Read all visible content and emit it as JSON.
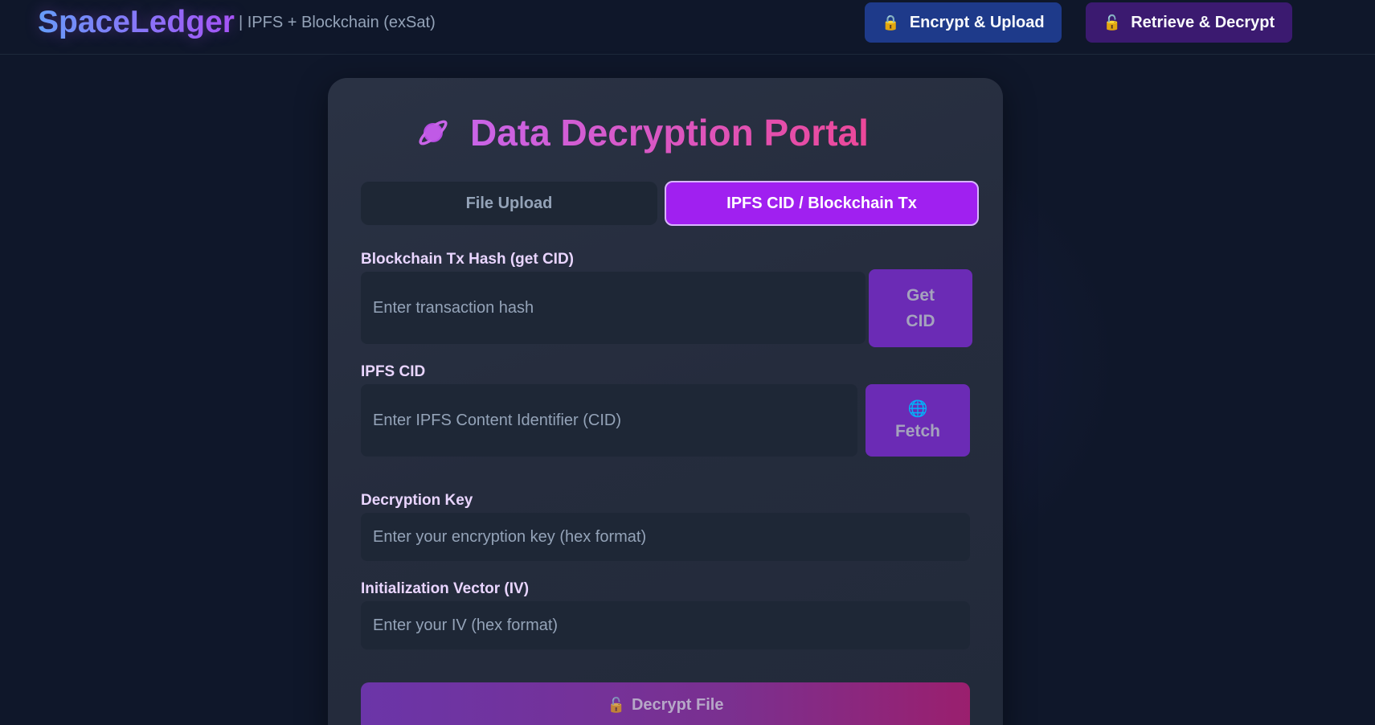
{
  "header": {
    "brand": "SpaceLedger",
    "subtitle": "| IPFS + Blockchain (exSat)",
    "nav": {
      "encrypt_icon": "lock-icon",
      "encrypt_label": "Encrypt & Upload",
      "decrypt_icon": "unlock-icon",
      "decrypt_label": "Retrieve & Decrypt"
    }
  },
  "card": {
    "title_icon": "planet-icon",
    "title": "Data Decryption Portal",
    "tabs": [
      {
        "label": "File Upload",
        "active": false
      },
      {
        "label": "IPFS CID / Blockchain Tx",
        "active": true
      }
    ],
    "tx_hash": {
      "label": "Blockchain Tx Hash (get CID)",
      "value": "",
      "placeholder": "Enter transaction hash",
      "button_line1": "Get",
      "button_line2": "CID"
    },
    "ipfs_cid": {
      "label": "IPFS CID",
      "value": "",
      "placeholder": "Enter IPFS Content Identifier (CID)",
      "button_icon": "globe-icon",
      "button_label": "Fetch"
    },
    "decryption_key": {
      "label": "Decryption Key",
      "value": "",
      "placeholder": "Enter your encryption key (hex format)"
    },
    "iv": {
      "label": "Initialization Vector (IV)",
      "value": "",
      "placeholder": "Enter your IV (hex format)"
    },
    "decrypt_button": {
      "icon": "unlock-icon",
      "label": "Decrypt File"
    }
  },
  "colors": {
    "background": "#0f172a",
    "accent_purple": "#a020f0",
    "accent_pink": "#ec4899",
    "brand_blue": "#60a5fa"
  }
}
